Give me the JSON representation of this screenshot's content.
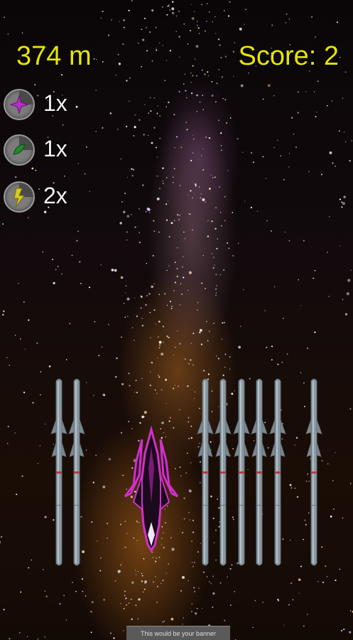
{
  "hud": {
    "distance": "374 m",
    "score": "Score: 2"
  },
  "powerups": [
    {
      "icon": "plus-cross-icon",
      "color": "#b030c0",
      "count": "1x"
    },
    {
      "icon": "green-leaf-icon",
      "color": "#1f8a2a",
      "count": "1x"
    },
    {
      "icon": "lightning-bolt-icon",
      "color": "#d8cc20",
      "count": "2x"
    }
  ],
  "banner": {
    "text": "This would be your banner"
  },
  "colors": {
    "hud_text": "#e6e600",
    "missile": "#8a98a2",
    "ship": "#d030c8"
  }
}
